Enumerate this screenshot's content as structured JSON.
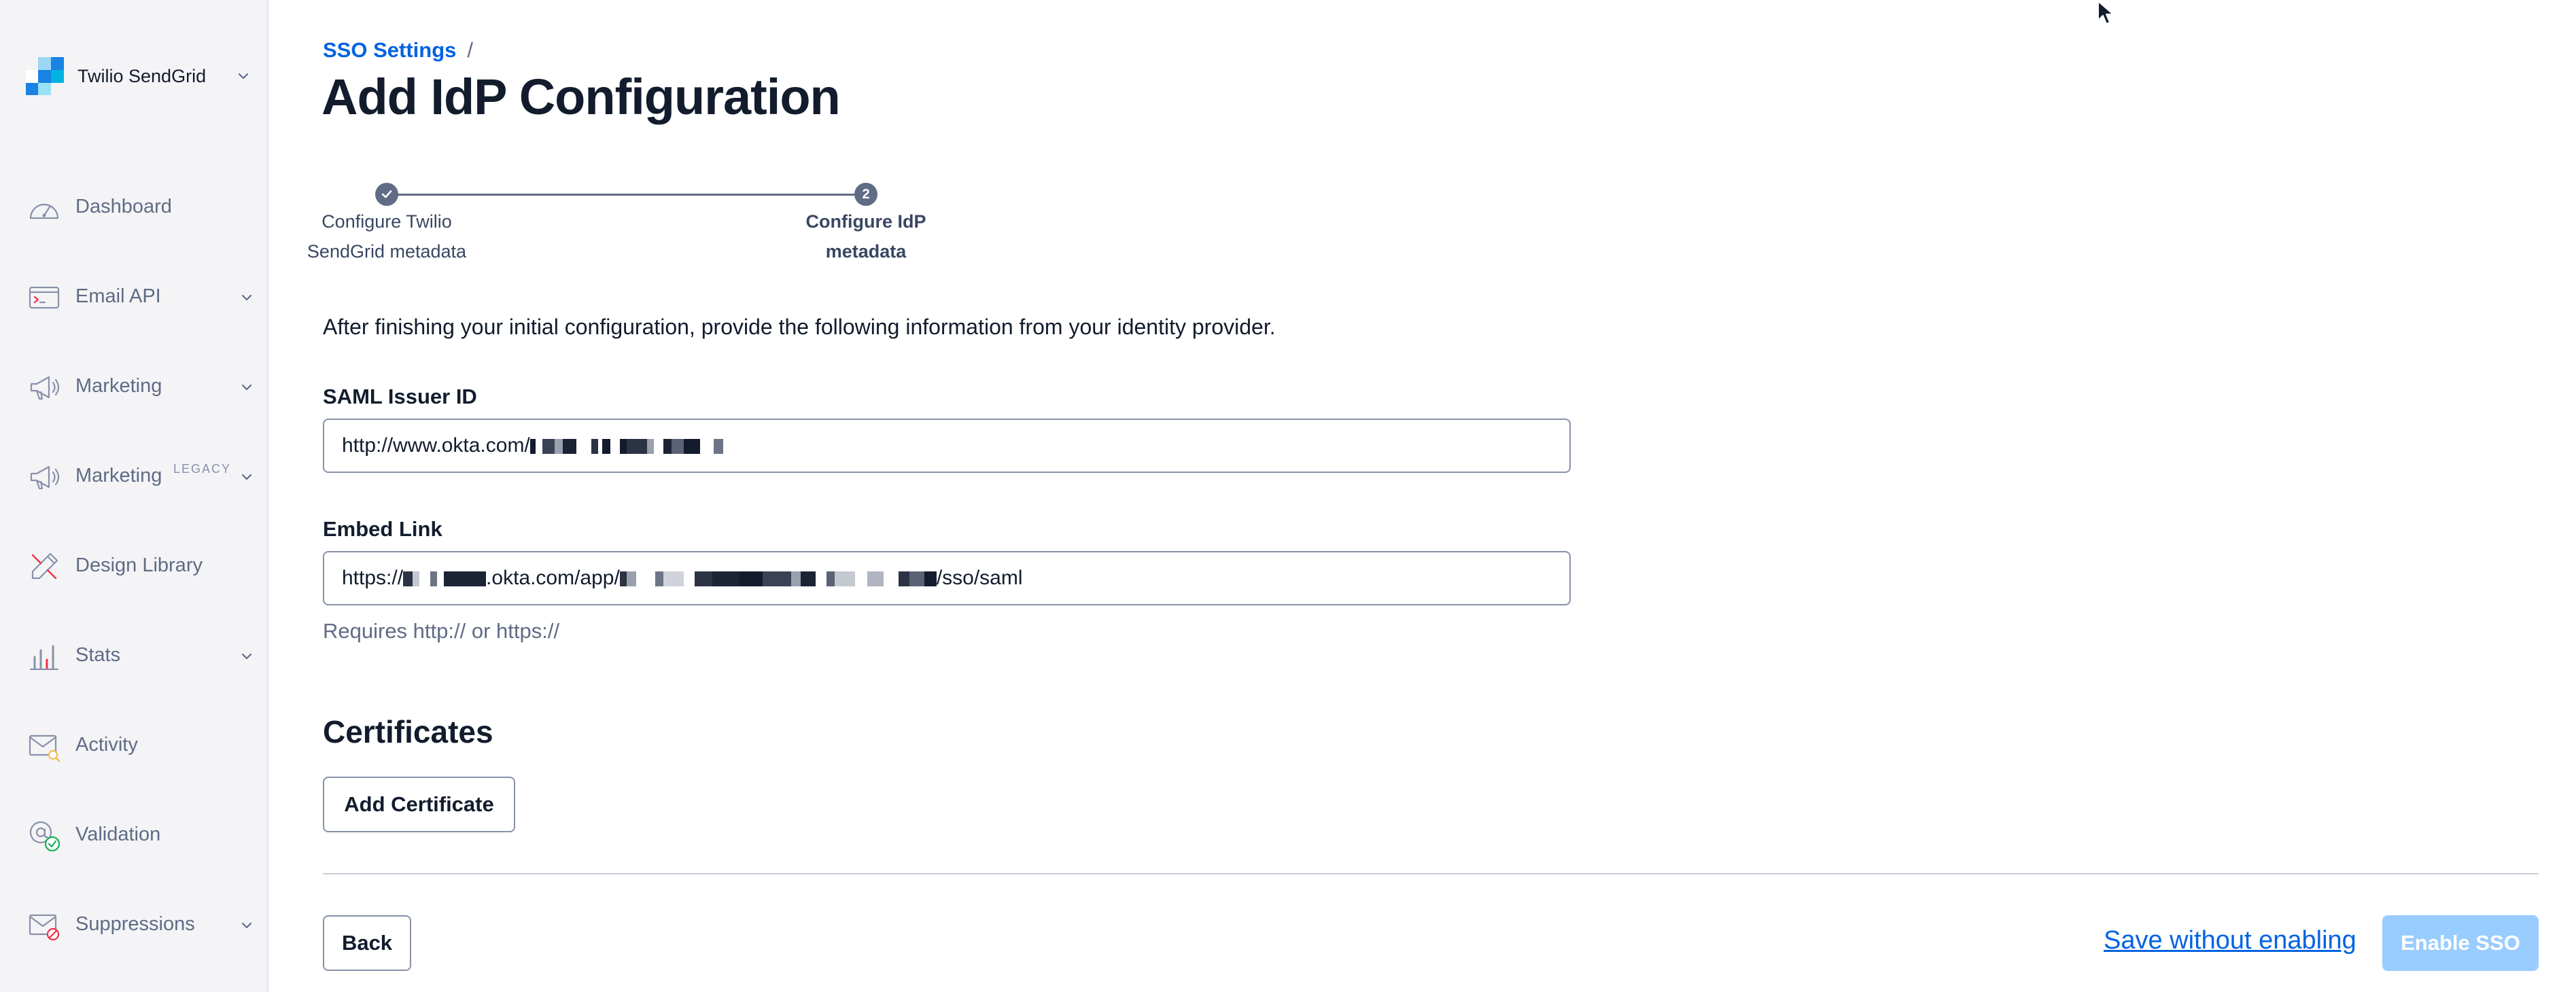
{
  "brand": {
    "name": "Twilio SendGrid"
  },
  "sidebar": {
    "items": [
      {
        "label": "Dashboard",
        "icon": "dashboard-gauge-icon",
        "chevron": false
      },
      {
        "label": "Email API",
        "icon": "email-api-icon",
        "chevron": true
      },
      {
        "label": "Marketing",
        "icon": "megaphone-icon",
        "chevron": true
      },
      {
        "label": "Marketing",
        "badge": "LEGACY",
        "icon": "megaphone-icon",
        "chevron": true
      },
      {
        "label": "Design Library",
        "icon": "design-library-icon",
        "chevron": false
      },
      {
        "label": "Stats",
        "icon": "stats-bar-chart-icon",
        "chevron": true
      },
      {
        "label": "Activity",
        "icon": "activity-envelope-icon",
        "chevron": false
      },
      {
        "label": "Validation",
        "icon": "validation-at-check-icon",
        "chevron": false
      },
      {
        "label": "Suppressions",
        "icon": "suppressions-envelope-icon",
        "chevron": true
      }
    ]
  },
  "breadcrumb": {
    "parent": "SSO Settings",
    "separator": "/"
  },
  "page": {
    "title": "Add IdP Configuration"
  },
  "stepper": {
    "steps": [
      {
        "number": "✓",
        "line1": "Configure Twilio",
        "line2": "SendGrid metadata",
        "state": "complete"
      },
      {
        "number": "2",
        "line1": "Configure IdP",
        "line2": "metadata",
        "state": "current"
      }
    ]
  },
  "intro": "After finishing your initial configuration, provide the following information from your identity provider.",
  "form": {
    "saml_issuer_id": {
      "label": "SAML Issuer ID",
      "value_prefix": "http://www.okta.com/"
    },
    "embed_link": {
      "label": "Embed Link",
      "value_prefix": "https://",
      "value_mid": ".okta.com/app/",
      "value_suffix": "/sso/saml",
      "help": "Requires http:// or https://"
    }
  },
  "certificates": {
    "title": "Certificates",
    "add_label": "Add Certificate"
  },
  "footer": {
    "back_label": "Back",
    "save_without_enabling_label": "Save without enabling",
    "enable_label": "Enable SSO"
  },
  "colors": {
    "link": "#0263e0",
    "text": "#121c2d",
    "muted": "#606b85",
    "disabled_primary": "#99cdff",
    "sidebar_bg": "#f4f4f6"
  }
}
